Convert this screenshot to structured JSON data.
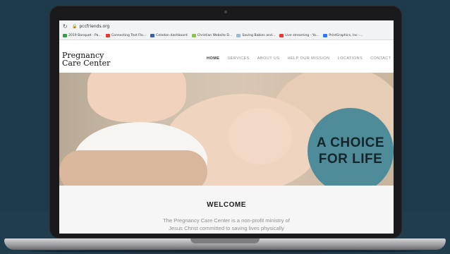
{
  "browser": {
    "url": "pccfriends.org",
    "bookmarks": [
      {
        "label": "2019 Banquet - Pa...",
        "color": "#3c9a4a"
      },
      {
        "label": "Connecting Text Flo...",
        "color": "#e53935"
      },
      {
        "label": "Celedon dashboard",
        "color": "#3a5fa8"
      },
      {
        "label": "Christian Website D...",
        "color": "#8bc34a"
      },
      {
        "label": "Saving Babies and...",
        "color": "#9fb9d4"
      },
      {
        "label": "Live streaming - Yo...",
        "color": "#e53935"
      },
      {
        "label": "PrintGraphics, Inc -...",
        "color": "#2979ff"
      }
    ]
  },
  "site": {
    "logo_line1": "Pregnancy",
    "logo_line2": "Care Center",
    "nav": [
      "HOME",
      "SERVICES",
      "ABOUT US",
      "HELP OUR MISSION",
      "LOCATIONS",
      "CONTACT"
    ],
    "hero_badge": {
      "line1": "A CHOICE",
      "line2": "FOR LIFE"
    },
    "welcome_title": "WELCOME",
    "welcome_line1": "The Pregnancy Care Center is a non-profit ministry of",
    "welcome_line2": "Jesus Christ committed to saving lives physically"
  },
  "colors": {
    "background": "#1d3a4b",
    "badge": "#4f8c99",
    "nav_active": "#333333"
  }
}
